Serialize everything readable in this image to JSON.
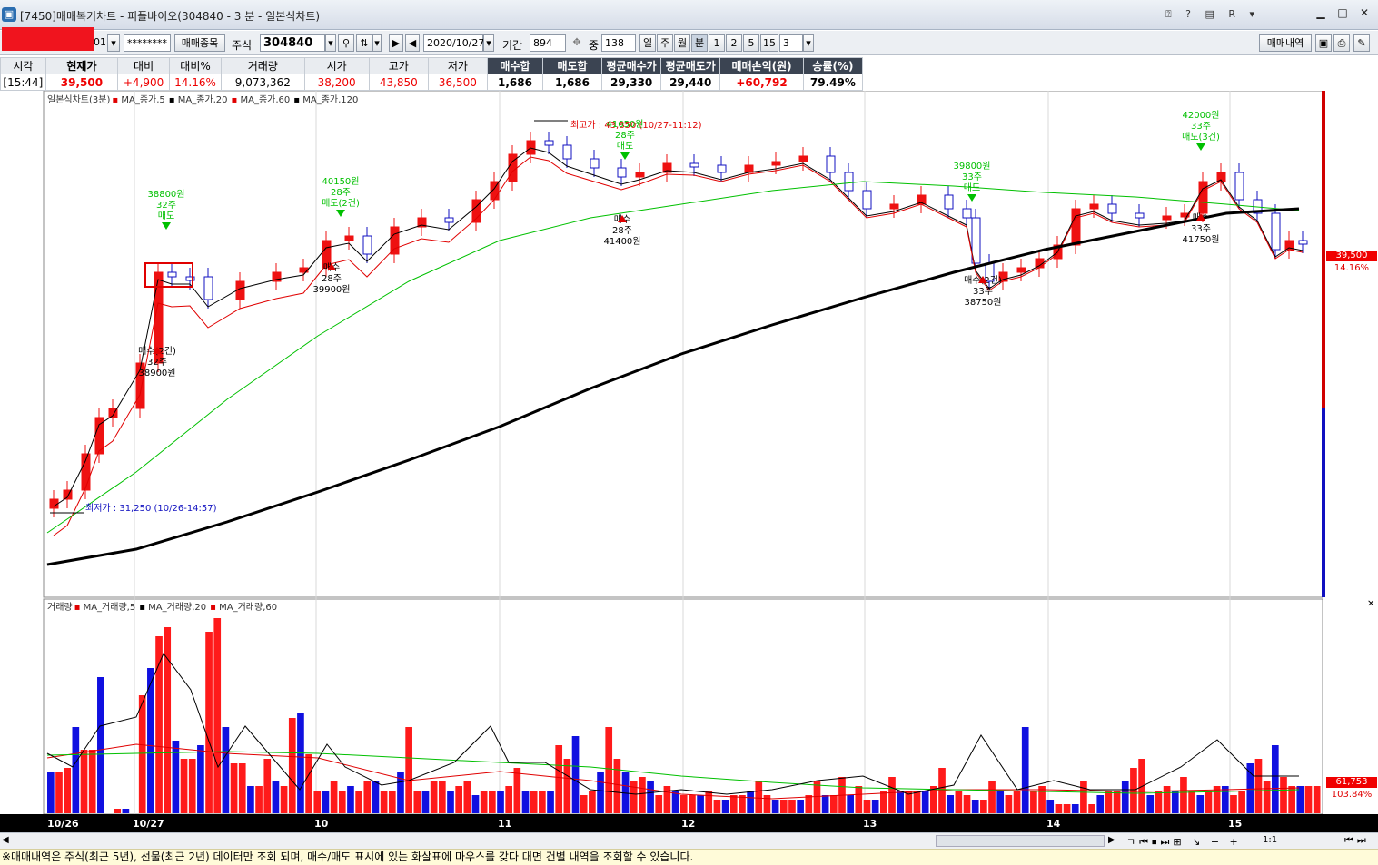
{
  "window": {
    "title": "[7450]매매복기차트 - 피플바이오(304840 - 3 분 - 일본식차트)",
    "toolbar_icons": "⍰ ? ▤ R ▾"
  },
  "toolbar": {
    "account_suffix": "01",
    "password_mask": "********",
    "trade_items_button": "매매종목",
    "stock_label": "주식",
    "stock_code": "304840",
    "date": "2020/10/27",
    "period_label": "기간",
    "period_value": "894",
    "middle_label": "중",
    "middle_value": "138",
    "period_buttons": [
      "일",
      "주",
      "월",
      "분",
      "1",
      "2",
      "5",
      "15"
    ],
    "minute_value": "3",
    "trade_history_button": "매매내역"
  },
  "quote": {
    "headers": [
      "시각",
      "현재가",
      "대비",
      "대비%",
      "거래량",
      "시가",
      "고가",
      "저가",
      "매수합",
      "매도합",
      "평균매수가",
      "평균매도가",
      "매매손익(원)",
      "승률(%)"
    ],
    "values": [
      "[15:44]",
      "39,500",
      "+4,900",
      "14.16%",
      "9,073,362",
      "38,200",
      "43,850",
      "36,500",
      "1,686",
      "1,686",
      "29,330",
      "29,440",
      "+60,792",
      "79.49%"
    ]
  },
  "price_chart": {
    "legend_title": "일본식차트(3분)",
    "legend_items": [
      {
        "label": "MA_종가,5",
        "color": "#e00000"
      },
      {
        "label": "MA_종가,20",
        "color": "#000000"
      },
      {
        "label": "MA_종가,60",
        "color": "#e00000"
      },
      {
        "label": "MA_종가,120",
        "color": "#000000"
      }
    ],
    "high_label": "최고가 : 43,850 (10/27-11:12)",
    "low_label": "최저가 : 31,250 (10/26-14:57)",
    "current_price": "39,500",
    "current_pct": "14.16%",
    "annotations": [
      {
        "text": [
          "38800원",
          "32주",
          "매도"
        ],
        "color": "#00c000",
        "arrow": "down"
      },
      {
        "text": [
          "매수(2건)",
          "32주",
          "38900원"
        ],
        "color": "#000000",
        "arrow": "up"
      },
      {
        "text": [
          "40150원",
          "28주",
          "매도(2건)"
        ],
        "color": "#00c000",
        "arrow": "down"
      },
      {
        "text": [
          "매수",
          "28주",
          "39900원"
        ],
        "color": "#000000",
        "arrow": "up"
      },
      {
        "text": [
          "41650원",
          "28주",
          "매도"
        ],
        "color": "#00c000",
        "arrow": "down"
      },
      {
        "text": [
          "매수",
          "28주",
          "41400원"
        ],
        "color": "#000000",
        "arrow": "up"
      },
      {
        "text": [
          "39800원",
          "33주",
          "매도"
        ],
        "color": "#00c000",
        "arrow": "down"
      },
      {
        "text": [
          "매수(2건)",
          "33주",
          "38750원"
        ],
        "color": "#000000",
        "arrow": "up"
      },
      {
        "text": [
          "42000원",
          "33주",
          "매도(3건)"
        ],
        "color": "#00c000",
        "arrow": "down"
      },
      {
        "text": [
          "매수",
          "33주",
          "41750원"
        ],
        "color": "#000000",
        "arrow": "up"
      }
    ]
  },
  "volume_chart": {
    "legend_title": "거래량",
    "legend_items": [
      {
        "label": "MA_거래량,5",
        "color": "#e00000"
      },
      {
        "label": "MA_거래량,20",
        "color": "#000000"
      },
      {
        "label": "MA_거래량,60",
        "color": "#e00000"
      }
    ],
    "current_volume": "61,753",
    "current_pct": "103.84%"
  },
  "x_axis": {
    "labels": [
      "10/26",
      "10/27",
      "10",
      "11",
      "12",
      "13",
      "14",
      "15"
    ]
  },
  "status_bar": {
    "text": "※매매내역은 주식(최근 5년), 선물(최근 2년) 데이터만 조회 되며, 매수/매도 표시에 있는 화살표에 마우스를 갖다 대면 건별 내역을 조회할 수 있습니다."
  },
  "scroll": {
    "zoom_label": "1:1"
  },
  "colors": {
    "up": "#ee1111",
    "down": "#1010e0",
    "ma5": "#000000",
    "ma20": "#e00000",
    "ma60": "#00c000",
    "ma120": "#000000"
  }
}
